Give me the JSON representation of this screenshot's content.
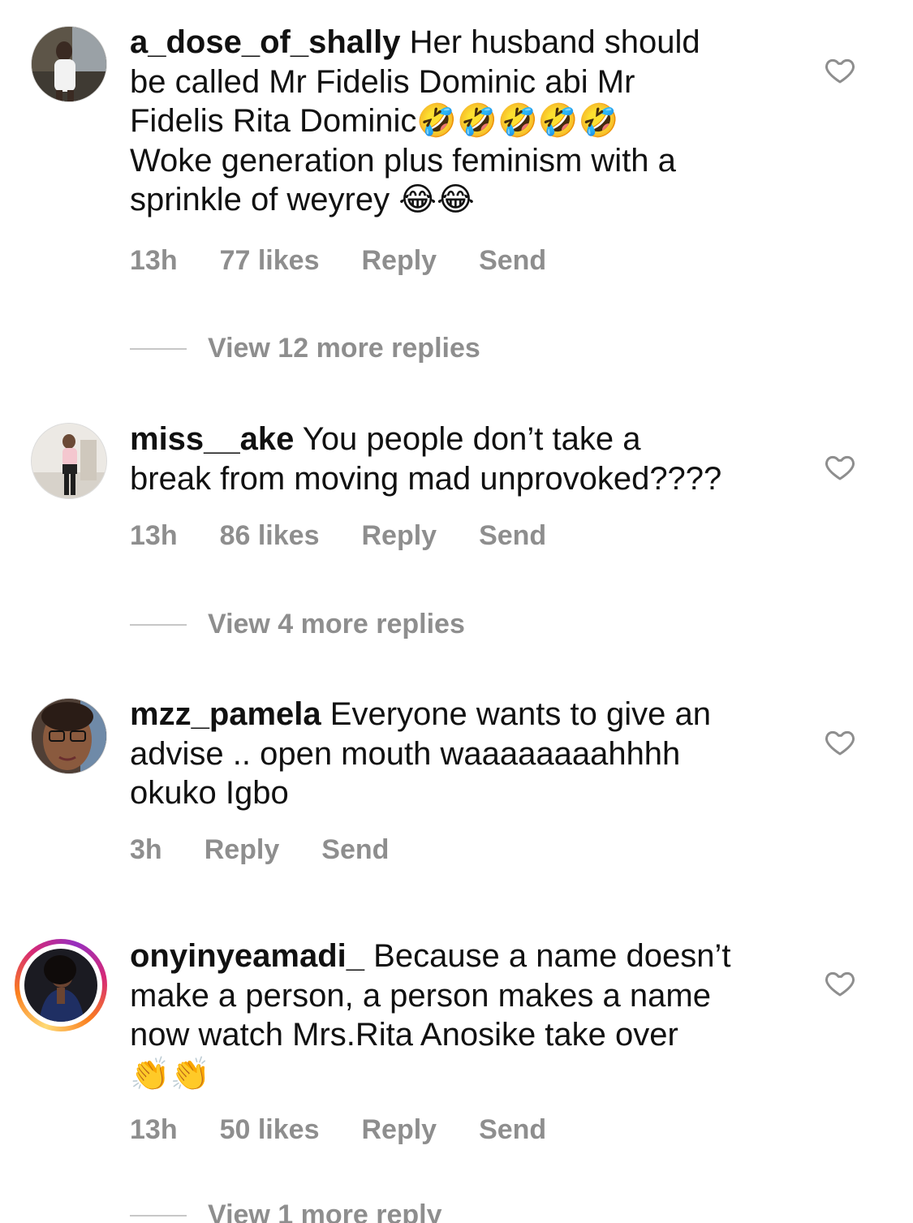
{
  "comments": [
    {
      "username": "a_dose_of_shally",
      "text_lines": [
        "Her husband should",
        "be called Mr Fidelis Dominic abi Mr",
        "Fidelis Rita Dominic🤣🤣🤣🤣🤣",
        "Woke generation plus feminism with a",
        "sprinkle of weyrey 😂😂"
      ],
      "time": "13h",
      "likes": "77 likes",
      "reply": "Reply",
      "send": "Send",
      "view_replies": "View 12 more replies"
    },
    {
      "username": "miss__ake",
      "text_lines": [
        "You people don’t take a",
        "break from moving mad unprovoked????"
      ],
      "time": "13h",
      "likes": "86 likes",
      "reply": "Reply",
      "send": "Send",
      "view_replies": "View 4 more replies"
    },
    {
      "username": "mzz_pamela",
      "text_lines": [
        "Everyone wants to give an",
        "advise .. open mouth waaaaaaaahhhh",
        "okuko Igbo"
      ],
      "time": "3h",
      "reply": "Reply",
      "send": "Send"
    },
    {
      "username": "onyinyeamadi_",
      "text_lines": [
        "Because a name doesn’t",
        "make a person, a person makes a name",
        "now watch Mrs.Rita Anosike take over",
        "👏👏"
      ],
      "time": "13h",
      "likes": "50 likes",
      "reply": "Reply",
      "send": "Send",
      "view_replies": "View 1 more reply"
    }
  ],
  "icons": {
    "like": "heart-outline-icon"
  },
  "colors": {
    "text": "#111111",
    "meta": "#8e8e8e",
    "divider": "#c7c7c7",
    "story_ring": [
      "#feda75",
      "#fa7e1e",
      "#d62976",
      "#962fbf"
    ]
  }
}
